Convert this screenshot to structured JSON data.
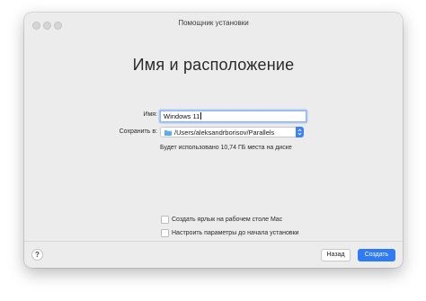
{
  "window": {
    "title": "Помощник установки",
    "heading": "Имя и расположение"
  },
  "form": {
    "name_label": "Имя:",
    "name_value": "Windows 11",
    "save_label": "Сохранить в:",
    "save_path": "/Users/aleksandrborisov/Parallels",
    "disk_usage": "Будет использовано 10,74 ГБ места на диске"
  },
  "options": [
    {
      "label": "Создать ярлык на рабочем столе Mac",
      "checked": false
    },
    {
      "label": "Настроить параметры до начала установки",
      "checked": false
    }
  ],
  "footer": {
    "help_label": "?",
    "back_label": "Назад",
    "create_label": "Создать"
  },
  "colors": {
    "accent": "#2f7bf6",
    "window_bg": "#ececec"
  }
}
